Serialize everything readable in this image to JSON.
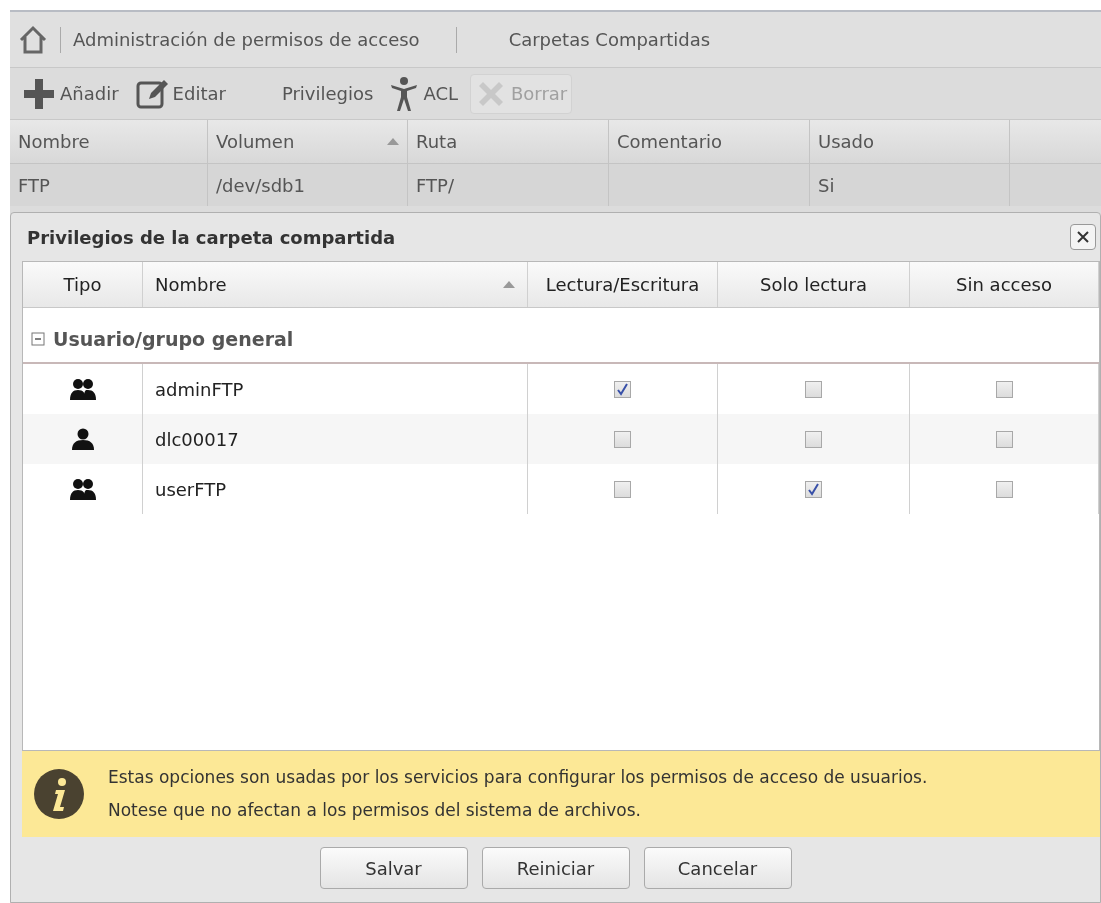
{
  "breadcrumb": [
    "Administración de permisos de acceso",
    "Carpetas Compartidas"
  ],
  "toolbar": [
    {
      "label": "Añadir",
      "kind": "add",
      "disabled": false
    },
    {
      "label": "Editar",
      "kind": "edit",
      "disabled": false
    },
    {
      "label": "Privilegios",
      "kind": "none",
      "disabled": false
    },
    {
      "label": "ACL",
      "kind": "acl",
      "disabled": false
    },
    {
      "label": "Borrar",
      "kind": "delete",
      "disabled": true
    }
  ],
  "table": {
    "columns": [
      {
        "label": "Nombre",
        "sorted": false
      },
      {
        "label": "Volumen",
        "sorted": true
      },
      {
        "label": "Ruta",
        "sorted": false
      },
      {
        "label": "Comentario",
        "sorted": false
      },
      {
        "label": "Usado",
        "sorted": false
      }
    ],
    "rows": [
      [
        "FTP",
        "/dev/sdb1",
        "FTP/",
        "",
        "Si"
      ]
    ]
  },
  "dialog": {
    "title": "Privilegios de la carpeta compartida",
    "columns": [
      {
        "label": "Tipo",
        "sorted": false
      },
      {
        "label": "Nombre",
        "sorted": true
      },
      {
        "label": "Lectura/Escritura",
        "sorted": false
      },
      {
        "label": "Solo lectura",
        "sorted": false
      },
      {
        "label": "Sin acceso",
        "sorted": false
      }
    ],
    "group": {
      "label": "Usuario/grupo general",
      "expanded": true
    },
    "rows": [
      {
        "kind": "group",
        "name": "adminFTP",
        "perms": [
          true,
          false,
          false
        ]
      },
      {
        "kind": "user",
        "name": "dlc00017",
        "perms": [
          false,
          false,
          false
        ]
      },
      {
        "kind": "group",
        "name": "userFTP",
        "perms": [
          false,
          true,
          false
        ]
      }
    ],
    "info": [
      "Estas opciones son usadas por los servicios para configurar los permisos de acceso de usuarios.",
      "Notese que no afectan a los permisos del sistema de archivos."
    ],
    "buttons": [
      "Salvar",
      "Reiniciar",
      "Cancelar"
    ]
  }
}
